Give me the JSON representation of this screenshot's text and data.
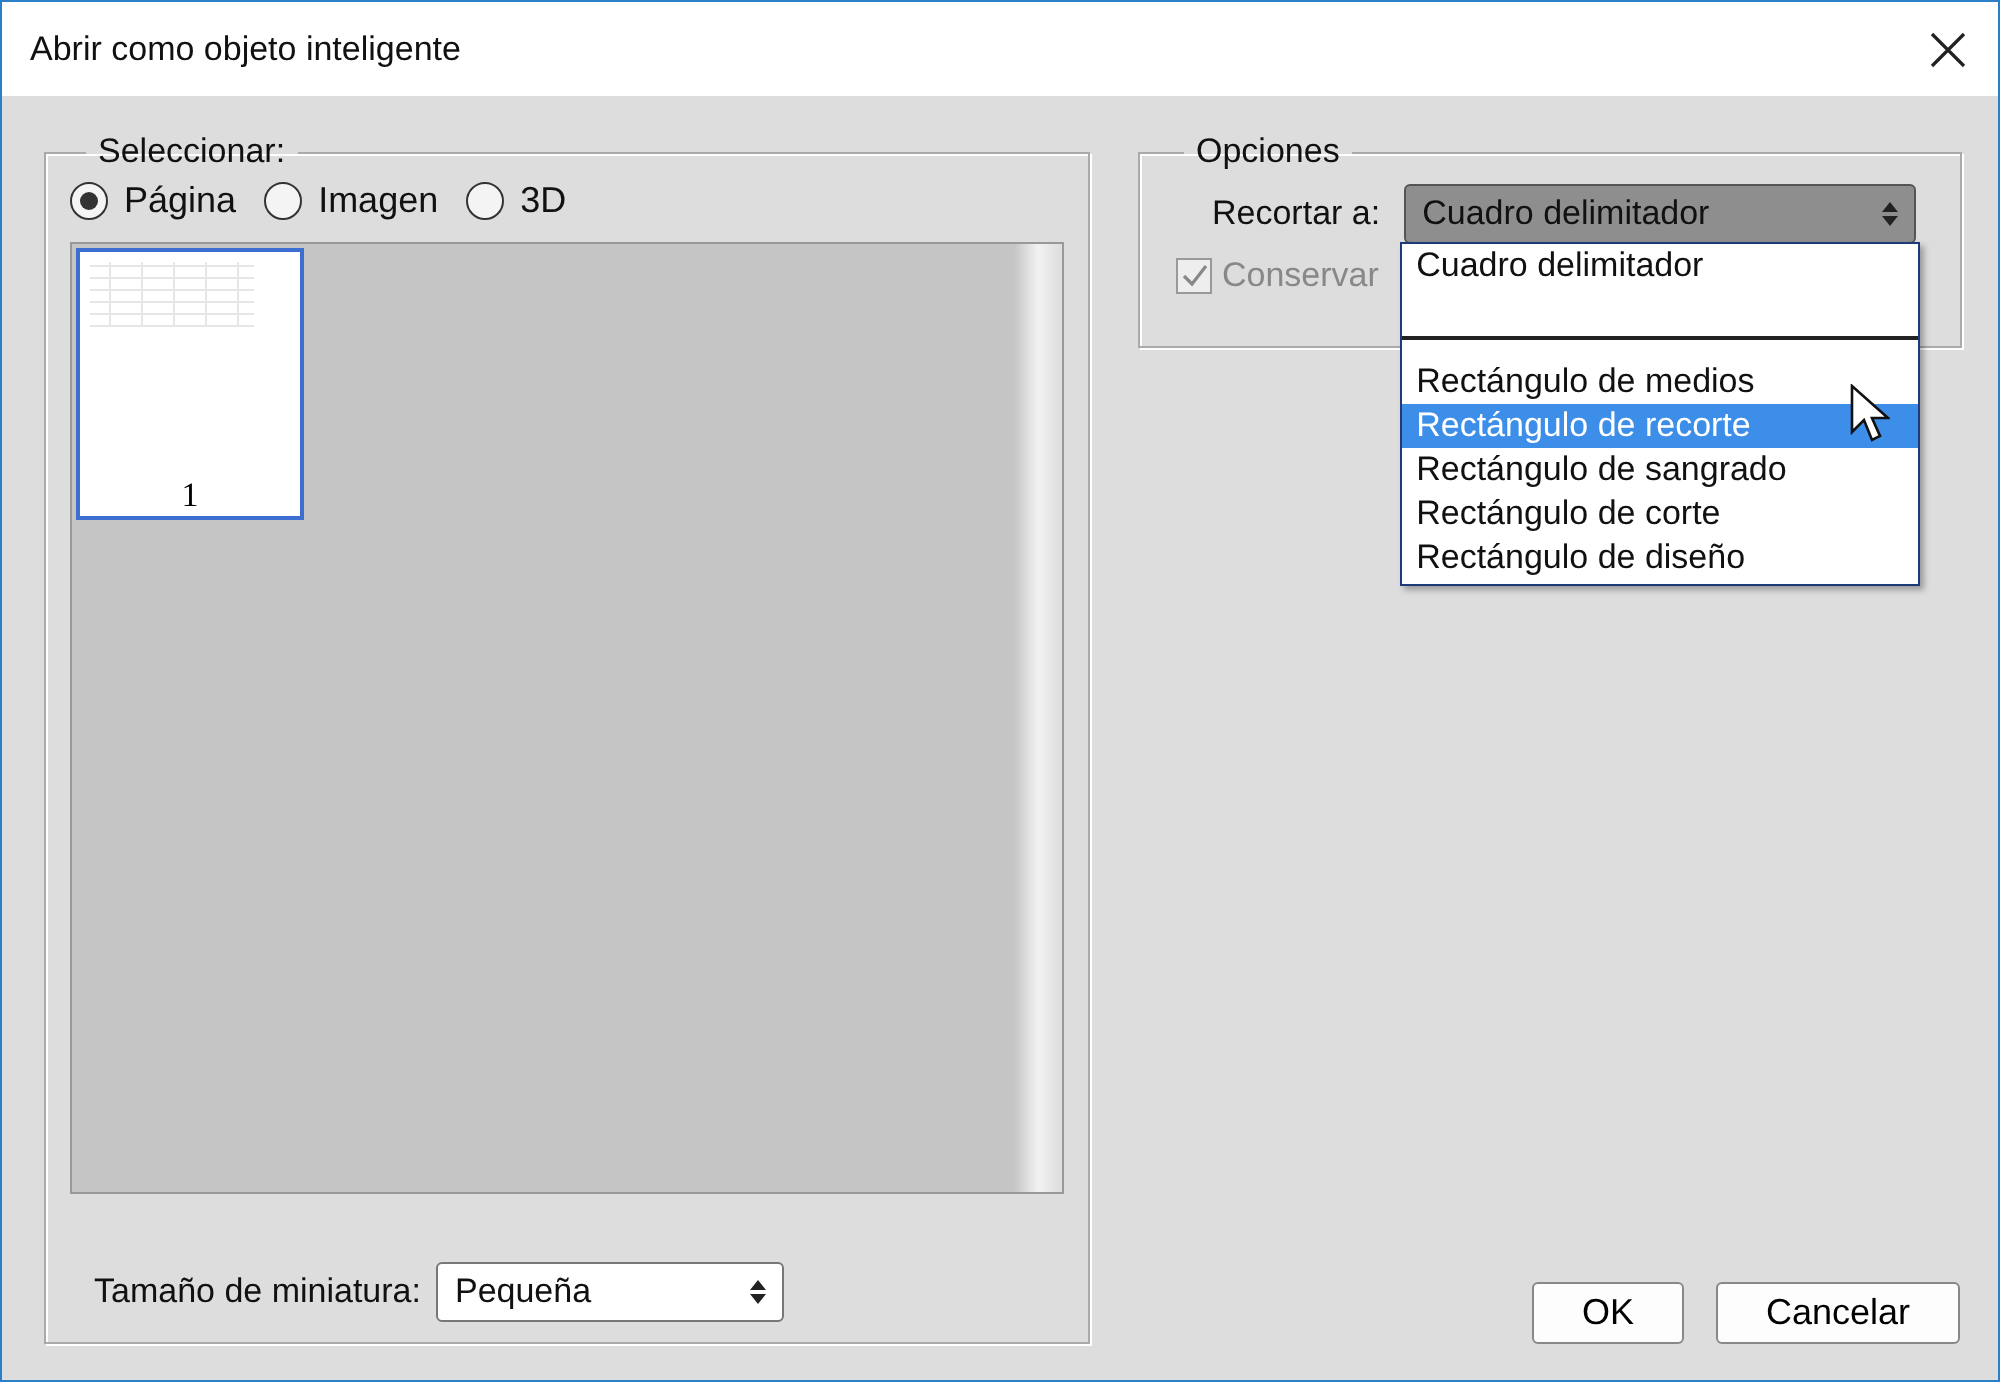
{
  "window": {
    "title": "Abrir como objeto inteligente"
  },
  "select_group": {
    "legend": "Seleccionar:",
    "radios": [
      {
        "label": "Página",
        "selected": true
      },
      {
        "label": "Imagen",
        "selected": false
      },
      {
        "label": "3D",
        "selected": false
      }
    ],
    "thumbnails": [
      {
        "label": "1",
        "selected": true
      }
    ],
    "thumbnail_size": {
      "label": "Tamaño de miniatura:",
      "value": "Pequeña"
    }
  },
  "options_group": {
    "legend": "Opciones",
    "crop_label": "Recortar a:",
    "crop_value": "Cuadro delimitador",
    "checkbox": {
      "label": "Conservar",
      "checked": true,
      "disabled": true
    },
    "menu": [
      {
        "kind": "option",
        "label": "Cuadro delimitador",
        "selected": false
      },
      {
        "kind": "separator"
      },
      {
        "kind": "option",
        "label": "Rectángulo de medios",
        "selected": false
      },
      {
        "kind": "option",
        "label": "Rectángulo de recorte",
        "selected": true
      },
      {
        "kind": "option",
        "label": "Rectángulo de sangrado",
        "selected": false
      },
      {
        "kind": "option",
        "label": "Rectángulo de corte",
        "selected": false
      },
      {
        "kind": "option",
        "label": "Rectángulo de diseño",
        "selected": false
      }
    ]
  },
  "buttons": [
    {
      "label": "OK"
    },
    {
      "label": "Cancelar"
    }
  ]
}
